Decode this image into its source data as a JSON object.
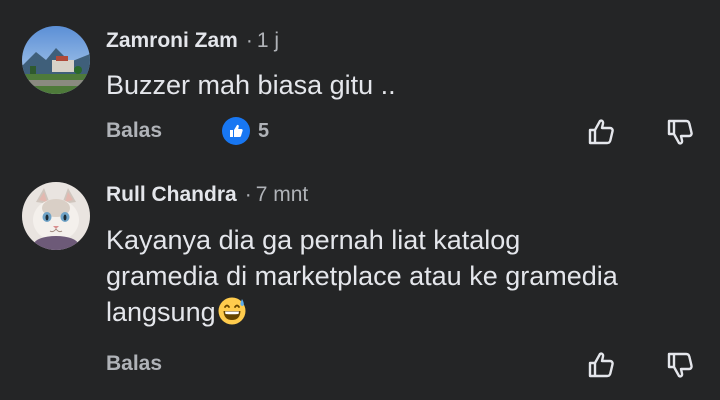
{
  "comments": [
    {
      "author": "Zamroni Zam",
      "separator": "·",
      "time": "1 j",
      "text_lines": [
        "Buzzer mah biasa gitu .."
      ],
      "reply_label": "Balas",
      "like_count": "5",
      "reaction_icon": "thumbs-up-icon",
      "upvote_icon": "upvote-icon",
      "downvote_icon": "downvote-icon"
    },
    {
      "author": "Rull Chandra",
      "separator": "·",
      "time": "7 mnt",
      "text_lines": [
        "Kayanya dia ga pernah liat katalog",
        "gramedia di marketplace atau ke gramedia",
        "langsung"
      ],
      "emoji": "grinning-sweat-emoji",
      "reply_label": "Balas",
      "upvote_icon": "upvote-icon",
      "downvote_icon": "downvote-icon"
    }
  ],
  "colors": {
    "background": "#242526",
    "primary_text": "#e4e6eb",
    "secondary_text": "#b0b3b8",
    "like_blue": "#1877f2"
  }
}
